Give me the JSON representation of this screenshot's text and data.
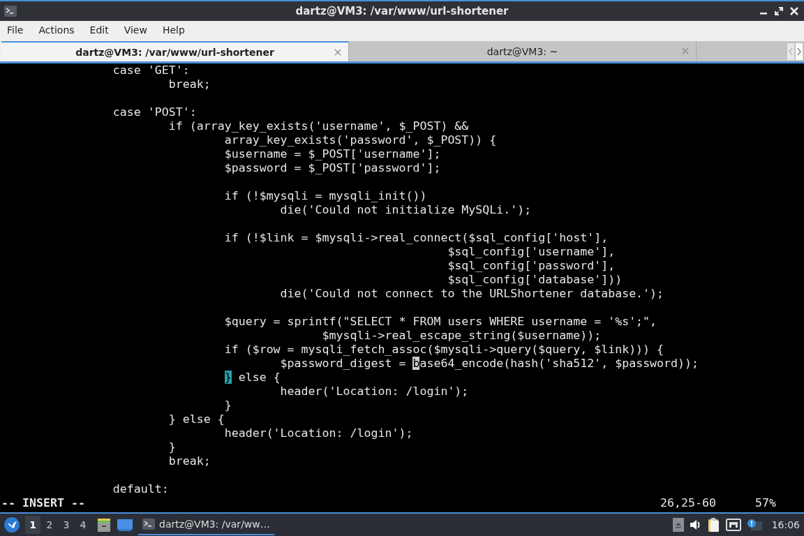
{
  "window": {
    "title": "dartz@VM3: /var/www/url-shortener"
  },
  "menu": [
    "File",
    "Actions",
    "Edit",
    "View",
    "Help"
  ],
  "tabs": [
    {
      "label": "dartz@VM3: /var/www/url-shortener",
      "selected": true
    },
    {
      "label": "dartz@VM3: ~",
      "selected": false
    }
  ],
  "editor": {
    "lines": [
      {
        "kind": "code",
        "segments": [
          {
            "kind": "plain",
            "text": "                case 'GET':"
          }
        ]
      },
      {
        "kind": "code",
        "segments": [
          {
            "kind": "plain",
            "text": "                        break;"
          }
        ]
      },
      {
        "kind": "blank"
      },
      {
        "kind": "code",
        "segments": [
          {
            "kind": "plain",
            "text": "                case 'POST':"
          }
        ]
      },
      {
        "kind": "code",
        "segments": [
          {
            "kind": "plain",
            "text": "                        if (array_key_exists('username', $_POST) &&"
          }
        ]
      },
      {
        "kind": "code",
        "segments": [
          {
            "kind": "plain",
            "text": "                                array_key_exists('password', $_POST)) {"
          }
        ]
      },
      {
        "kind": "code",
        "segments": [
          {
            "kind": "plain",
            "text": "                                $username = $_POST['username'];"
          }
        ]
      },
      {
        "kind": "code",
        "segments": [
          {
            "kind": "plain",
            "text": "                                $password = $_POST['password'];"
          }
        ]
      },
      {
        "kind": "blank"
      },
      {
        "kind": "code",
        "segments": [
          {
            "kind": "plain",
            "text": "                                if (!$mysqli = mysqli_init())"
          }
        ]
      },
      {
        "kind": "code",
        "segments": [
          {
            "kind": "plain",
            "text": "                                        die('Could not initialize MySQLi.');"
          }
        ]
      },
      {
        "kind": "blank"
      },
      {
        "kind": "code",
        "segments": [
          {
            "kind": "plain",
            "text": "                                if (!$link = $mysqli->real_connect($sql_config['host'],"
          }
        ]
      },
      {
        "kind": "code",
        "segments": [
          {
            "kind": "plain",
            "text": "                                                                $sql_config['username'],"
          }
        ]
      },
      {
        "kind": "code",
        "segments": [
          {
            "kind": "plain",
            "text": "                                                                $sql_config['password'],"
          }
        ]
      },
      {
        "kind": "code",
        "segments": [
          {
            "kind": "plain",
            "text": "                                                                $sql_config['database']))"
          }
        ]
      },
      {
        "kind": "code",
        "segments": [
          {
            "kind": "plain",
            "text": "                                        die('Could not connect to the URLShortener database.');"
          }
        ]
      },
      {
        "kind": "blank"
      },
      {
        "kind": "code",
        "segments": [
          {
            "kind": "plain",
            "text": "                                $query = sprintf(\"SELECT * FROM users WHERE username = '%s';\","
          }
        ]
      },
      {
        "kind": "code",
        "segments": [
          {
            "kind": "plain",
            "text": "                                              $mysqli->real_escape_string($username));"
          }
        ]
      },
      {
        "kind": "code",
        "segments": [
          {
            "kind": "plain",
            "text": "                                if ($row = mysqli_fetch_assoc($mysqli->query($query, $link))) {"
          }
        ]
      },
      {
        "kind": "code",
        "segments": [
          {
            "kind": "plain",
            "text": "                                        $password_digest = "
          },
          {
            "kind": "cursor",
            "text": "b"
          },
          {
            "kind": "plain",
            "text": "ase64_encode(hash('sha512', $password));"
          }
        ]
      },
      {
        "kind": "code",
        "segments": [
          {
            "kind": "match",
            "text": "                                }"
          },
          {
            "kind": "plain",
            "text": " else {"
          }
        ]
      },
      {
        "kind": "code",
        "segments": [
          {
            "kind": "plain",
            "text": "                                        header('Location: /login');"
          }
        ]
      },
      {
        "kind": "code",
        "segments": [
          {
            "kind": "plain",
            "text": "                                }"
          }
        ]
      },
      {
        "kind": "code",
        "segments": [
          {
            "kind": "plain",
            "text": "                        } else {"
          }
        ]
      },
      {
        "kind": "code",
        "segments": [
          {
            "kind": "plain",
            "text": "                                header('Location: /login');"
          }
        ]
      },
      {
        "kind": "code",
        "segments": [
          {
            "kind": "plain",
            "text": "                        }"
          }
        ]
      },
      {
        "kind": "code",
        "segments": [
          {
            "kind": "plain",
            "text": "                        break;"
          }
        ]
      },
      {
        "kind": "blank"
      },
      {
        "kind": "code",
        "segments": [
          {
            "kind": "plain",
            "text": "                default:"
          }
        ]
      }
    ],
    "mode": "-- INSERT --",
    "position": "26,25-60",
    "scroll": "57%"
  },
  "taskbar": {
    "workspaces": [
      {
        "label": "1",
        "selected": true
      },
      {
        "label": "2",
        "selected": false
      },
      {
        "label": "3",
        "selected": false
      },
      {
        "label": "4",
        "selected": false
      }
    ],
    "task": "dartz@VM3: /var/ww…",
    "clock": "16:06"
  }
}
